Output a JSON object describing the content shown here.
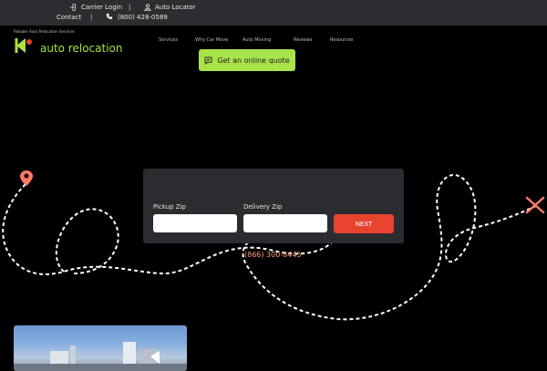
{
  "topbar": {
    "carrier_login": "Carrier Login",
    "separator": "|",
    "auto_locator": "Auto Locator",
    "contact": "Contact",
    "phone": "(800) 428-0589",
    "icons": [
      "login-icon",
      "user-icon",
      "phone-icon"
    ]
  },
  "logo": {
    "tagline": "Reliable Auto Relocation Services",
    "name": "auto relocation"
  },
  "nav": {
    "items": [
      "Services",
      "Why Car Move",
      "Auto Moving",
      "Reviews",
      "Resources"
    ]
  },
  "cta": {
    "quote_label": "Get an online quote",
    "icon": "chat-icon"
  },
  "quote_form": {
    "pickup_label": "Pickup Zip",
    "pickup_value": "",
    "delivery_label": "Delivery Zip",
    "delivery_value": "",
    "next_label": "NEXT"
  },
  "hero": {
    "phone": "(866) 300-8445",
    "start_marker": "location-pin-icon",
    "end_marker": "x-mark-icon"
  },
  "colors": {
    "background": "#000000",
    "topbar": "#2b2d30",
    "accent_green": "#a9e34b",
    "accent_red": "#e8432f",
    "card": "#2a2c30"
  }
}
